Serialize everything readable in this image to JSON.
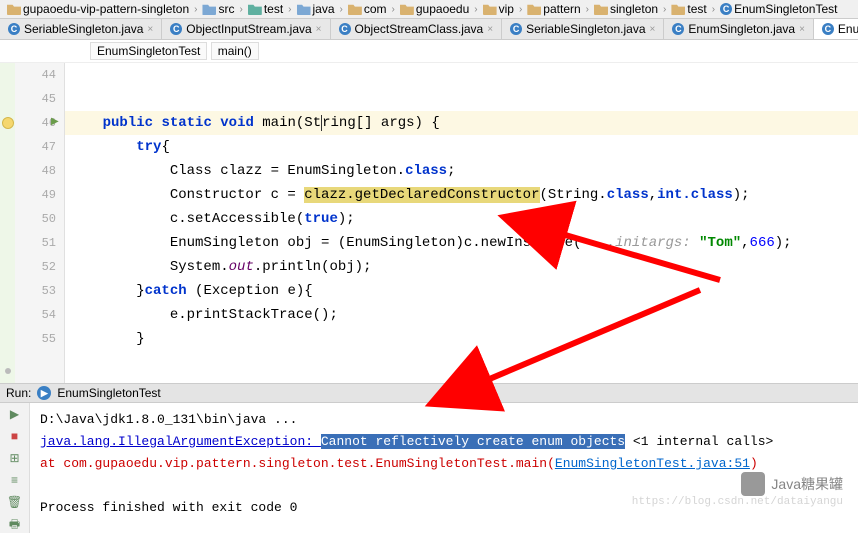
{
  "breadcrumb": [
    {
      "icon": "folder",
      "label": "gupaoedu-vip-pattern-singleton"
    },
    {
      "icon": "folder-blue",
      "label": "src"
    },
    {
      "icon": "folder-blue",
      "label": "test"
    },
    {
      "icon": "folder-blue",
      "label": "java"
    },
    {
      "icon": "folder",
      "label": "com"
    },
    {
      "icon": "folder",
      "label": "gupaoedu"
    },
    {
      "icon": "folder",
      "label": "vip"
    },
    {
      "icon": "folder",
      "label": "pattern"
    },
    {
      "icon": "folder",
      "label": "singleton"
    },
    {
      "icon": "folder",
      "label": "test"
    },
    {
      "icon": "class",
      "label": "EnumSingletonTest"
    }
  ],
  "tabs": [
    {
      "icon": "class",
      "label": "SeriableSingleton.java",
      "active": false
    },
    {
      "icon": "class",
      "label": "ObjectInputStream.java",
      "active": false
    },
    {
      "icon": "class",
      "label": "ObjectStreamClass.java",
      "active": false
    },
    {
      "icon": "class",
      "label": "SeriableSingleton.java",
      "active": false
    },
    {
      "icon": "class",
      "label": "EnumSingleton.java",
      "active": false
    },
    {
      "icon": "class",
      "label": "EnumSingletonTest.java",
      "active": true
    }
  ],
  "context": {
    "cls": "EnumSingletonTest",
    "method": "main()"
  },
  "gutter": {
    "start": 44,
    "end": 55,
    "highlight": 46
  },
  "code": {
    "l46_kw_public": "public",
    "l46_kw_static": "static",
    "l46_kw_void": "void",
    "l46_main": "main",
    "l46_str": "St",
    "l46_ring": "ring",
    "l46_args": "[] args) {",
    "l47_try": "try",
    "l47_brace": "{",
    "l48_pre": "            Class clazz = EnumSingleton.",
    "l48_class": "class",
    "l48_semi": ";",
    "l49_pre": "            Constructor c = ",
    "l49_hl": "clazz.getDeclaredConstructor",
    "l49_paren": "(String.",
    "l49_class1": "class",
    "l49_comma": ",",
    "l49_int": "int",
    "l49_class2": ".class",
    "l49_end": ");",
    "l50_pre": "            c.setAccessible(",
    "l50_true": "true",
    "l50_end": ");",
    "l51_pre": "            EnumSingleton obj = (EnumSingleton)c.newInstance( ",
    "l51_initargs": "...initargs:",
    "l51_sp": " ",
    "l51_tom": "\"Tom\"",
    "l51_comma": ",",
    "l51_num": "666",
    "l51_end": ");",
    "l52_pre": "            System.",
    "l52_out": "out",
    "l52_println": ".println(obj);",
    "l53_catch": "catch",
    "l53_pre": "        }",
    "l53_rest": " (Exception e){",
    "l54": "            e.printStackTrace();",
    "l55": "        }"
  },
  "run": {
    "title": "Run:",
    "config": "EnumSingletonTest",
    "cmd": "D:\\Java\\jdk1.8.0_131\\bin\\java ...",
    "ex_class": "java.lang.IllegalArgumentException: ",
    "ex_msg": "Cannot reflectively create enum objects",
    "internal": " <1 internal calls>",
    "at": "    at com.gupaoedu.vip.pattern.singleton.test.EnumSingletonTest.main(",
    "link": "EnumSingletonTest.java:51",
    "at_end": ")",
    "finished": "Process finished with exit code 0"
  },
  "watermark": {
    "text": "Java糖果罐",
    "url": "https://blog.csdn.net/dataiyangu"
  }
}
